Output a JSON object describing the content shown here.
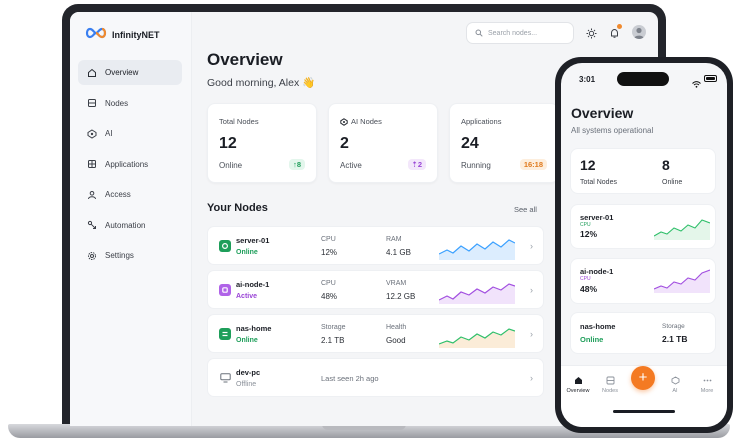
{
  "brand": {
    "name": "InfinityNET"
  },
  "sidebar": {
    "items": [
      {
        "label": "Overview",
        "icon": "home-icon"
      },
      {
        "label": "Nodes",
        "icon": "nodes-icon"
      },
      {
        "label": "AI",
        "icon": "ai-icon"
      },
      {
        "label": "Applications",
        "icon": "apps-icon"
      },
      {
        "label": "Access",
        "icon": "user-icon"
      },
      {
        "label": "Automation",
        "icon": "automation-icon"
      },
      {
        "label": "Settings",
        "icon": "gear-icon"
      }
    ]
  },
  "topbar": {
    "search_placeholder": "Search nodes..."
  },
  "main": {
    "title": "Overview",
    "greeting": "Good morning, Alex 👋",
    "stats": [
      {
        "label": "Total Nodes",
        "value": "12",
        "sub": "Online",
        "badge": "↑8",
        "badge_color": "#1e9e5a",
        "badge_bg": "#e3f6ec"
      },
      {
        "label": "AI Nodes",
        "value": "2",
        "sub": "Active",
        "badge": "⇡2",
        "badge_color": "#9a45d6",
        "badge_bg": "#f3e7fb"
      },
      {
        "label": "Applications",
        "value": "24",
        "sub": "Running",
        "badge": "16:18",
        "badge_color": "#e07a1c",
        "badge_bg": "#fdeedd"
      }
    ],
    "nodes_title": "Your Nodes",
    "see_all": "See all",
    "nodes": [
      {
        "name": "server-01",
        "status": "Online",
        "status_color": "#1e9e5a",
        "m1_label": "CPU",
        "m1_value": "12%",
        "m2_label": "RAM",
        "m2_value": "4.1 GB",
        "color": "#3aa0ff"
      },
      {
        "name": "ai-node-1",
        "status": "Active",
        "status_color": "#9a45d6",
        "m1_label": "CPU",
        "m1_value": "48%",
        "m2_label": "VRAM",
        "m2_value": "12.2 GB",
        "color": "#a24fe0"
      },
      {
        "name": "nas-home",
        "status": "Online",
        "status_color": "#1e9e5a",
        "m1_label": "Storage",
        "m1_value": "2.1 TB",
        "m2_label": "Health",
        "m2_value": "Good",
        "color": "#2fbf6a"
      },
      {
        "name": "dev-pc",
        "status": "Offline",
        "status_color": "#8a9099",
        "m1_label": "Last seen 2h ago",
        "m1_value": "",
        "m2_label": "",
        "m2_value": "",
        "color": "#8a9099"
      }
    ]
  },
  "phone": {
    "time": "3:01",
    "title": "Overview",
    "subtitle": "All systems operational",
    "total_nodes_value": "12",
    "total_nodes_label": "Total Nodes",
    "online_value": "8",
    "online_label": "Online",
    "cards": [
      {
        "name": "server-01",
        "tag": "CPU",
        "metric": "12%"
      },
      {
        "name": "ai-node-1",
        "tag": "CPU",
        "metric": "48%"
      },
      {
        "name": "nas-home",
        "status": "Online",
        "label": "Storage",
        "value": "2.1 TB"
      }
    ],
    "tabs": [
      "Overview",
      "Nodes",
      "+",
      "AI",
      "More"
    ]
  }
}
